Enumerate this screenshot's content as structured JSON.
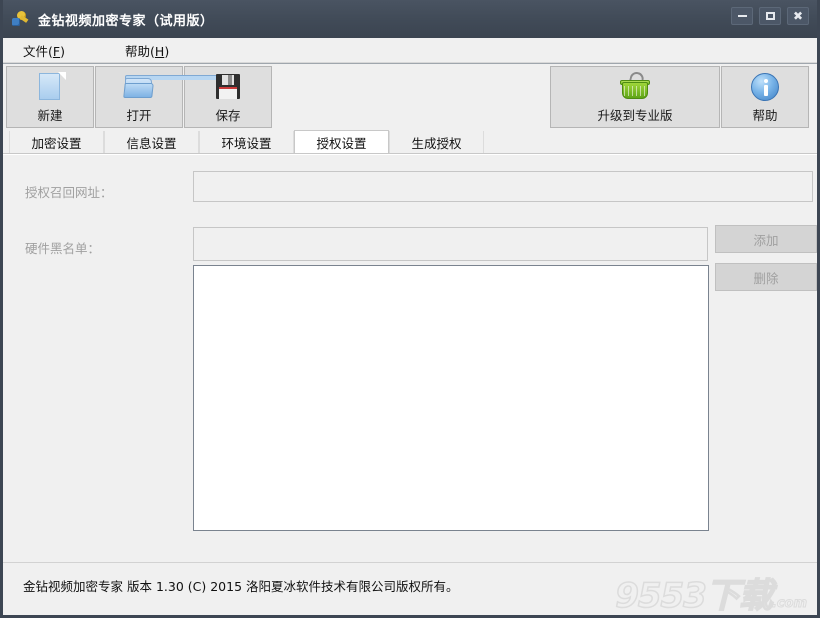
{
  "window": {
    "title": "金钻视频加密专家（试用版）",
    "icon": "key-icon",
    "controls": {
      "minimize_label": "最小化",
      "maximize_label": "最大化",
      "close_label": "关闭"
    }
  },
  "menubar": {
    "items": [
      {
        "label": "文件(F)",
        "text": "文件",
        "mnemonic": "F"
      },
      {
        "label": "帮助(H)",
        "text": "帮助",
        "mnemonic": "H"
      }
    ]
  },
  "toolbar": {
    "left_buttons": [
      {
        "label": "新建",
        "icon": "new-file-icon"
      },
      {
        "label": "打开",
        "icon": "open-folder-icon"
      },
      {
        "label": "保存",
        "icon": "save-floppy-icon"
      }
    ],
    "right_buttons": [
      {
        "label": "升级到专业版",
        "icon": "shopping-basket-icon"
      },
      {
        "label": "帮助",
        "icon": "info-circle-icon"
      }
    ]
  },
  "tabs": [
    {
      "label": "加密设置",
      "active": false
    },
    {
      "label": "信息设置",
      "active": false
    },
    {
      "label": "环境设置",
      "active": false
    },
    {
      "label": "授权设置",
      "active": true
    },
    {
      "label": "生成授权",
      "active": false
    }
  ],
  "panel": {
    "url_field": {
      "label": "授权召回网址：",
      "value": "",
      "placeholder": "",
      "disabled": true
    },
    "blacklist_field": {
      "label": "硬件黑名单：",
      "value": "",
      "placeholder": "",
      "disabled": true
    },
    "add_button": {
      "label": "添加",
      "disabled": true
    },
    "delete_button": {
      "label": "删除",
      "disabled": true
    },
    "blacklist_list": {
      "items": []
    }
  },
  "statusbar": {
    "text": "金钻视频加密专家  版本 1.30 (C)  2015 洛阳夏冰软件技术有限公司版权所有。"
  },
  "watermark": {
    "main": "9553下载",
    "sub": ".com"
  },
  "colors": {
    "titlebar": "#414b58",
    "frame": "#3d4653",
    "face": "#f0f0f0",
    "toolbar_button": "#dedede",
    "disabled_text": "#a0a0a0",
    "listbox_border": "#7a838f",
    "accent_blue": "#3d7fc4",
    "accent_green": "#5fa516"
  }
}
